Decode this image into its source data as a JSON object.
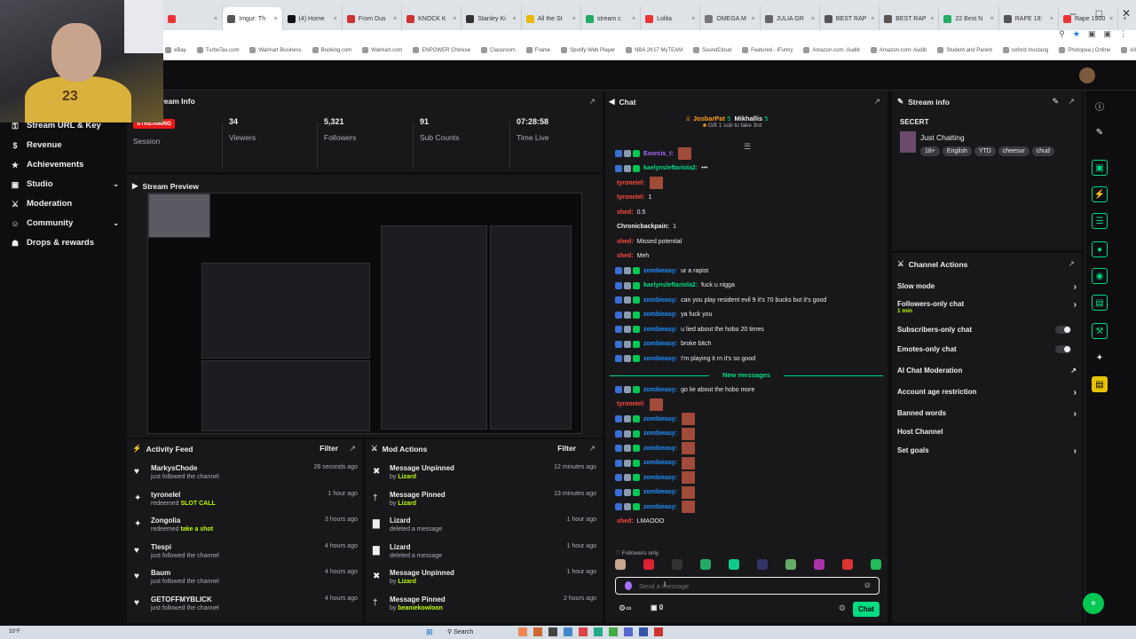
{
  "browser": {
    "tabs": [
      {
        "label": "",
        "color": "#e33",
        "active": false
      },
      {
        "label": "Imgur: Th",
        "color": "#555",
        "active": true
      },
      {
        "label": "(4) Home",
        "color": "#111",
        "active": false
      },
      {
        "label": "From Dus",
        "color": "#c33",
        "active": false
      },
      {
        "label": "KNOCK K",
        "color": "#c33",
        "active": false
      },
      {
        "label": "Stanley Ki",
        "color": "#333",
        "active": false
      },
      {
        "label": "All the St",
        "color": "#e6b800",
        "active": false
      },
      {
        "label": "stream c",
        "color": "#2a6",
        "active": false
      },
      {
        "label": "Lolita",
        "color": "#e33",
        "active": false
      },
      {
        "label": "OMEGA M",
        "color": "#777",
        "active": false
      },
      {
        "label": "JULIA GR",
        "color": "#666",
        "active": false
      },
      {
        "label": "BEST RAP",
        "color": "#555",
        "active": false
      },
      {
        "label": "BEST RAP",
        "color": "#555",
        "active": false
      },
      {
        "label": "22 Best N",
        "color": "#2a6",
        "active": false
      },
      {
        "label": "RAPE 19:",
        "color": "#555",
        "active": false
      },
      {
        "label": "Rape 1900",
        "color": "#e33",
        "active": false
      }
    ],
    "bookmarks": [
      "eBay",
      "TurboTax.com",
      "Walmart Business",
      "Booking.com",
      "Walmart.com",
      "ENPOWER Chinese",
      "Classroom",
      "Frame",
      "Spotify Web Player",
      "NBA 2K17 MyTEAM",
      "SoundCloud",
      "Featured - iFunny",
      "Amazon.com: Audib",
      "Amazon.com: Audib",
      "Student and Parent",
      "oxford mustang",
      "Photopea | Online",
      "All Bookmarks"
    ]
  },
  "sidebar": {
    "items": [
      {
        "label": "Stream URL & Key",
        "icon": "key-icon",
        "chevron": false
      },
      {
        "label": "Revenue",
        "icon": "dollar-icon",
        "chevron": false
      },
      {
        "label": "Achievements",
        "icon": "trophy-icon",
        "chevron": false
      },
      {
        "label": "Studio",
        "icon": "studio-icon",
        "chevron": true
      },
      {
        "label": "Moderation",
        "icon": "sword-icon",
        "chevron": false
      },
      {
        "label": "Community",
        "icon": "people-icon",
        "chevron": true
      },
      {
        "label": "Drops & rewards",
        "icon": "gift-icon",
        "chevron": false
      }
    ]
  },
  "stream_info": {
    "title": "Stream Info",
    "badge": "STREAMING",
    "stats": [
      {
        "value": "",
        "label": "Session"
      },
      {
        "value": "34",
        "label": "Viewers"
      },
      {
        "value": "5,321",
        "label": "Followers"
      },
      {
        "value": "91",
        "label": "Sub Counts"
      },
      {
        "value": "07:28:58",
        "label": "Time Live"
      }
    ]
  },
  "preview": {
    "title": "Stream Preview"
  },
  "activity_feed": {
    "title": "Activity Feed",
    "filter": "Filter",
    "items": [
      {
        "icon": "heart-icon",
        "name": "MarkysChode",
        "sub": "just followed the channel",
        "highlight": "",
        "time": "26 seconds ago"
      },
      {
        "icon": "points-icon",
        "name": "tyroneIel",
        "sub": "redeemed",
        "highlight": "SLOT CALL",
        "time": "1 hour ago"
      },
      {
        "icon": "points-icon",
        "name": "Zongolia",
        "sub": "redeemed",
        "highlight": "take a shot",
        "time": "3 hours ago"
      },
      {
        "icon": "heart-icon",
        "name": "Tlespi",
        "sub": "just followed the channel",
        "highlight": "",
        "time": "4 hours ago"
      },
      {
        "icon": "heart-icon",
        "name": "Baum",
        "sub": "just followed the channel",
        "highlight": "",
        "time": "4 hours ago"
      },
      {
        "icon": "heart-icon",
        "name": "GETOFFMYBLICK",
        "sub": "just followed the channel",
        "highlight": "",
        "time": "4 hours ago"
      }
    ]
  },
  "mod_actions": {
    "title": "Mod Actions",
    "filter": "Filter",
    "items": [
      {
        "icon": "unpin-icon",
        "name": "Message Unpinned",
        "sub": "by",
        "highlight": "Lizard",
        "time": "12 minutes ago"
      },
      {
        "icon": "pin-icon",
        "name": "Message Pinned",
        "sub": "by",
        "highlight": "Lizard",
        "time": "13 minutes ago"
      },
      {
        "icon": "trash-icon",
        "name": "Lizard",
        "sub": "deleted a message",
        "highlight": "",
        "time": "1 hour ago"
      },
      {
        "icon": "trash-icon",
        "name": "Lizard",
        "sub": "deleted a message",
        "highlight": "",
        "time": "1 hour ago"
      },
      {
        "icon": "unpin-icon",
        "name": "Message Unpinned",
        "sub": "by",
        "highlight": "Lizard",
        "time": "1 hour ago"
      },
      {
        "icon": "pin-icon",
        "name": "Message Pinned",
        "sub": "by",
        "highlight": "beaniekowloon",
        "time": "2 hours ago"
      }
    ]
  },
  "chat": {
    "title": "Chat",
    "pinned": {
      "user1": "JosbarPat",
      "user1_count": "5",
      "user2": "Mikhallis",
      "user2_count": "5",
      "gift": "Gift 1 sub to take 3rd"
    },
    "messages": [
      {
        "user": "Exorcis_t:",
        "color": "#a970ff",
        "text": "",
        "emote": true
      },
      {
        "user": "kaelynsleftariola2:",
        "color": "#00db84",
        "text": "•••",
        "emote": false
      },
      {
        "user": "tyroneIel:",
        "color": "#ff4a3d",
        "text": "",
        "emote": true
      },
      {
        "user": "tyroneIel:",
        "color": "#ff4a3d",
        "text": "1",
        "emote": false
      },
      {
        "user": "shed:",
        "color": "#ff4a3d",
        "text": "0.5",
        "emote": false
      },
      {
        "user": "Chronicbackpain:",
        "color": "#efeff1",
        "text": "1",
        "emote": false
      },
      {
        "user": "shed:",
        "color": "#ff4a3d",
        "text": "Missed potential",
        "emote": false
      },
      {
        "user": "shed:",
        "color": "#ff4a3d",
        "text": "Meh",
        "emote": false
      },
      {
        "user": "zombieasy:",
        "color": "#1e90ff",
        "text": "ur a rapist",
        "emote": false
      },
      {
        "user": "kaelynsleftariola2:",
        "color": "#00db84",
        "text": "fuck u nigga",
        "emote": false
      },
      {
        "user": "zombieasy:",
        "color": "#1e90ff",
        "text": "can you play resident evil 9 it's 70 bucks but it's good",
        "emote": false
      },
      {
        "user": "zombieasy:",
        "color": "#1e90ff",
        "text": "ya fuck you",
        "emote": false
      },
      {
        "user": "zombieasy:",
        "color": "#1e90ff",
        "text": "u lied about the hobo 20 times",
        "emote": false
      },
      {
        "user": "zombieasy:",
        "color": "#1e90ff",
        "text": "broke bitch",
        "emote": false
      },
      {
        "user": "zombieasy:",
        "color": "#1e90ff",
        "text": "I'm playing it rn it's so good",
        "emote": false
      }
    ],
    "new_messages_label": "New messages",
    "new_messages": [
      {
        "user": "zombieasy:",
        "color": "#1e90ff",
        "text": "go lie about the hobo more",
        "emote": false
      },
      {
        "user": "tyroneIel:",
        "color": "#ff4a3d",
        "text": "",
        "emote": true
      },
      {
        "user": "zombieasy:",
        "color": "#1e90ff",
        "text": "",
        "emote": true
      },
      {
        "user": "zombieasy:",
        "color": "#1e90ff",
        "text": "",
        "emote": true
      },
      {
        "user": "zombieasy:",
        "color": "#1e90ff",
        "text": "",
        "emote": true
      },
      {
        "user": "zombieasy:",
        "color": "#1e90ff",
        "text": "",
        "emote": true
      },
      {
        "user": "zombieasy:",
        "color": "#1e90ff",
        "text": "",
        "emote": true
      },
      {
        "user": "zombieasy:",
        "color": "#1e90ff",
        "text": "",
        "emote": true
      },
      {
        "user": "zombieasy:",
        "color": "#1e90ff",
        "text": "",
        "emote": true
      },
      {
        "user": "shed:",
        "color": "#ff4a3d",
        "text": "LMAOOO",
        "emote": false
      }
    ],
    "followers_only": "Followers only",
    "input_placeholder": "Send a message",
    "points": "0",
    "chat_button": "Chat"
  },
  "right_stream_info": {
    "title": "Stream info",
    "stream_title": "SECERT",
    "category": "Just Chatting",
    "tags": [
      "18+",
      "English",
      "YTD",
      "cheesur",
      "chud"
    ]
  },
  "channel_actions": {
    "title": "Channel Actions",
    "items": [
      {
        "label": "Slow mode",
        "sub": "",
        "control": "arrow"
      },
      {
        "label": "Followers-only chat",
        "sub": "1 min",
        "control": "arrow"
      },
      {
        "label": "Subscribers-only chat",
        "sub": "",
        "control": "toggle"
      },
      {
        "label": "Emotes-only chat",
        "sub": "",
        "control": "toggle"
      },
      {
        "label": "AI Chat Moderation",
        "sub": "",
        "control": "external"
      },
      {
        "label": "Account age restriction",
        "sub": "",
        "control": "arrow"
      },
      {
        "label": "Banned words",
        "sub": "",
        "control": "arrow"
      },
      {
        "label": "Host Channel",
        "sub": "",
        "control": "none"
      },
      {
        "label": "Set goals",
        "sub": "",
        "control": "arrow"
      }
    ]
  },
  "colors": {
    "accent": "#00db84",
    "lime": "#beff00",
    "live": "#e91916",
    "panel": "#18181b",
    "bg": "#0e0e10"
  },
  "taskbar": {
    "search": "Search",
    "weather": "33°F"
  }
}
